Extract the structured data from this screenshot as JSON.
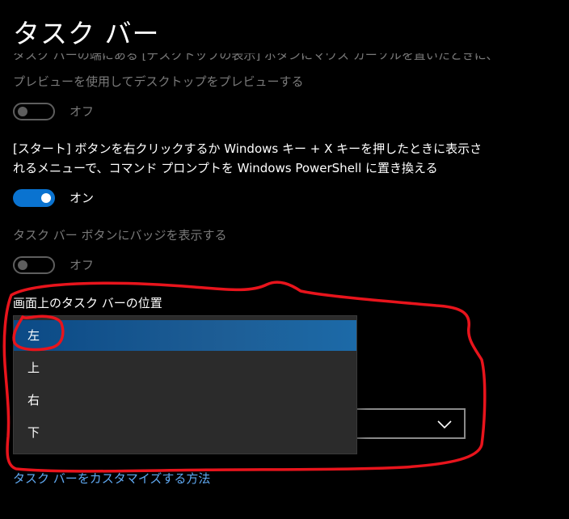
{
  "page": {
    "title": "タスク バー"
  },
  "settings": {
    "peek_clipped_line": "タスク バーの端にある [デスクトップの表示] ボタンにマウス カーソルを置いたときに、",
    "peek_line2": "プレビューを使用してデスクトップをプレビューする",
    "peek_toggle_label": "オフ",
    "powershell_line1": "[スタート] ボタンを右クリックするか Windows キー + X キーを押したときに表示さ",
    "powershell_line2": "れるメニューで、コマンド プロンプトを Windows PowerShell に置き換える",
    "powershell_toggle_label": "オン",
    "badges_text": "タスク バー ボタンにバッジを表示する",
    "badges_toggle_label": "オフ"
  },
  "position": {
    "label": "画面上のタスク バーの位置",
    "options": [
      "左",
      "上",
      "右",
      "下"
    ],
    "selected": "左"
  },
  "link": {
    "customize": "タスク バーをカスタマイズする方法"
  },
  "colors": {
    "background": "#000000",
    "accent": "#0a73d0",
    "link": "#5fa8f0",
    "annotation": "#e8141c"
  }
}
